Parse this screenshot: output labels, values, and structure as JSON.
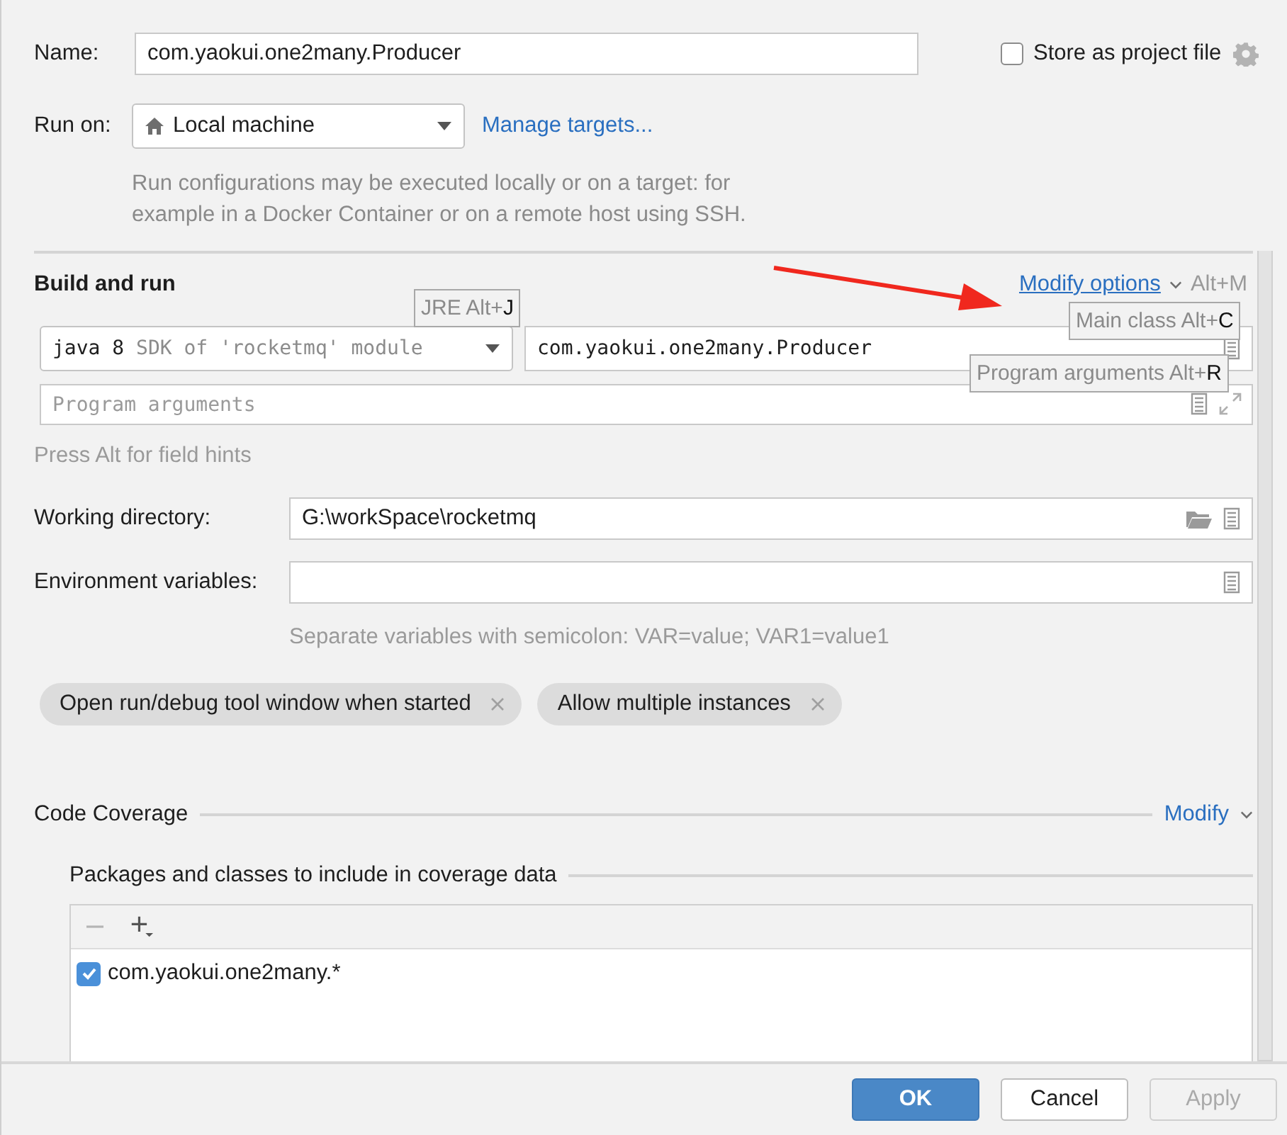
{
  "name": {
    "label": "Name:",
    "value": "com.yaokui.one2many.Producer"
  },
  "store_as_project_file": {
    "label": "Store as project file",
    "checked": false
  },
  "run_on": {
    "label": "Run on:",
    "value": "Local machine",
    "link": "Manage targets...",
    "description": "Run configurations may be executed locally or on a target: for example in a Docker Container or on a remote host using SSH."
  },
  "build_and_run": {
    "title": "Build and run",
    "modify_options": "Modify options",
    "modify_shortcut": "Alt+M",
    "jre": {
      "version": "java 8",
      "detail": "SDK of 'rocketmq' module"
    },
    "main_class": "com.yaokui.one2many.Producer",
    "program_arguments": {
      "placeholder": "Program arguments"
    },
    "field_hint": "Press Alt for field hints",
    "hints": [
      {
        "label": "JRE Alt+",
        "key": "J"
      },
      {
        "label": "Main class Alt+",
        "key": "C"
      },
      {
        "label": "Program arguments Alt+",
        "key": "R"
      }
    ]
  },
  "working_directory": {
    "label": "Working directory:",
    "value": "G:\\workSpace\\rocketmq"
  },
  "environment_variables": {
    "label": "Environment variables:",
    "hint": "Separate variables with semicolon: VAR=value; VAR1=value1"
  },
  "options": [
    {
      "label": "Open run/debug tool window when started"
    },
    {
      "label": "Allow multiple instances"
    }
  ],
  "code_coverage": {
    "title": "Code Coverage",
    "modify": "Modify",
    "packages_title": "Packages and classes to include in coverage data",
    "entries": [
      {
        "pattern": "com.yaokui.one2many.*",
        "checked": true
      }
    ]
  },
  "buttons": [
    {
      "label": "OK",
      "kind": "primary",
      "disabled": false
    },
    {
      "label": "Cancel",
      "kind": "default",
      "disabled": false
    },
    {
      "label": "Apply",
      "kind": "default",
      "disabled": true
    }
  ]
}
